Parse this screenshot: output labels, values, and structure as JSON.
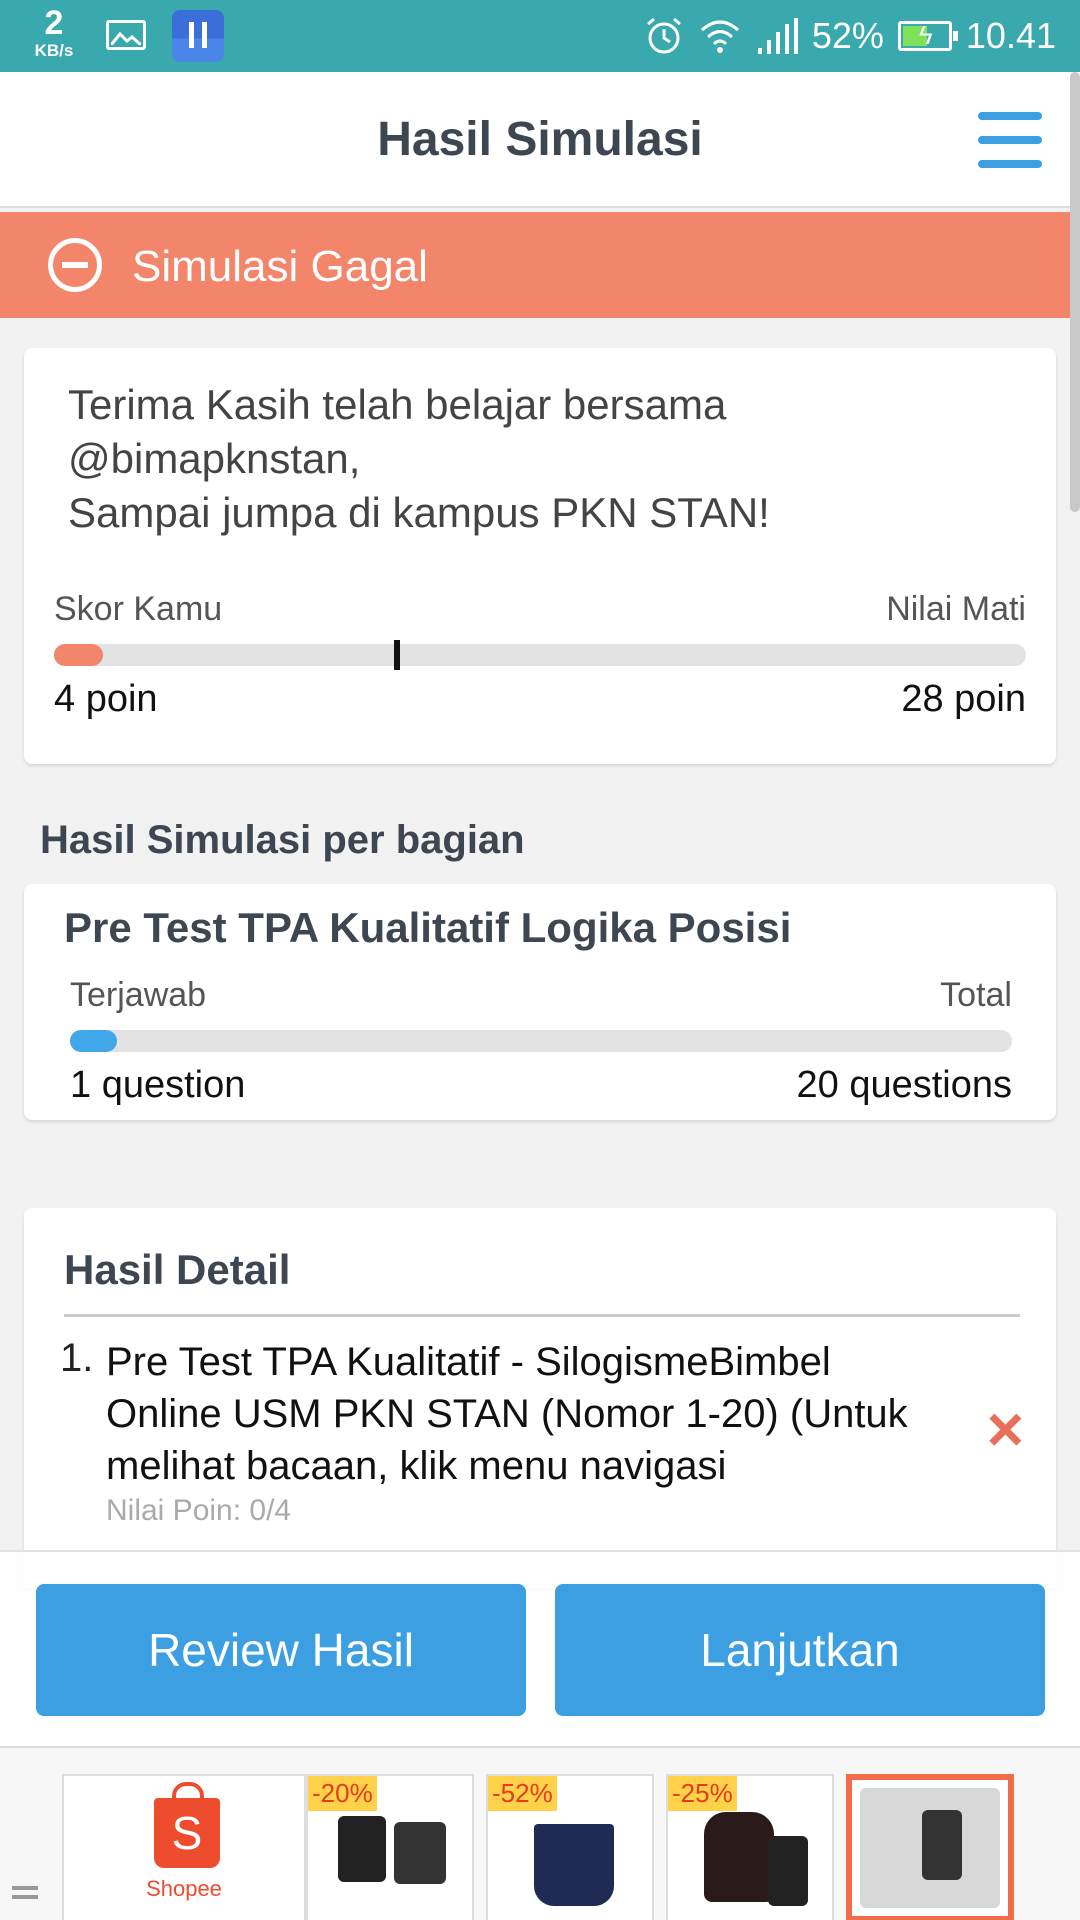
{
  "status_bar": {
    "net_speed": "2",
    "net_unit": "KB/s",
    "battery": "52%",
    "time": "10.41"
  },
  "header": {
    "title": "Hasil Simulasi"
  },
  "banner": {
    "text": "Simulasi Gagal",
    "color": "#f2856a"
  },
  "score": {
    "message": "Terima Kasih telah belajar bersama\n@bimapknstan,\nSampai jumpa di kampus PKN STAN!",
    "left_label": "Skor Kamu",
    "right_label": "Nilai Mati",
    "left_value": "4 poin",
    "right_value": "28 poin",
    "score_fraction": 0.05,
    "threshold_fraction": 0.35
  },
  "section": {
    "title": "Hasil Simulasi per bagian"
  },
  "part": {
    "title": "Pre Test TPA Kualitatif Logika Posisi",
    "left_label": "Terjawab",
    "right_label": "Total",
    "left_value": "1 question",
    "right_value": "20 questions",
    "progress_fraction": 0.05
  },
  "detail": {
    "title": "Hasil Detail",
    "items": [
      {
        "number": "1.",
        "text": "Pre Test TPA Kualitatif - SilogismeBimbel Online USM PKN STAN (Nomor 1-20) (Untuk melihat bacaan, klik menu navigasi",
        "points": "Nilai Poin: 0/4",
        "status_icon": "×"
      }
    ]
  },
  "buttons": {
    "review": "Review Hasil",
    "next": "Lanjutkan",
    "color": "#3b9fe1"
  },
  "ad": {
    "brand": "Shopee",
    "brand_letter": "S",
    "discounts": [
      "-20%",
      "-52%",
      "-25%"
    ]
  }
}
